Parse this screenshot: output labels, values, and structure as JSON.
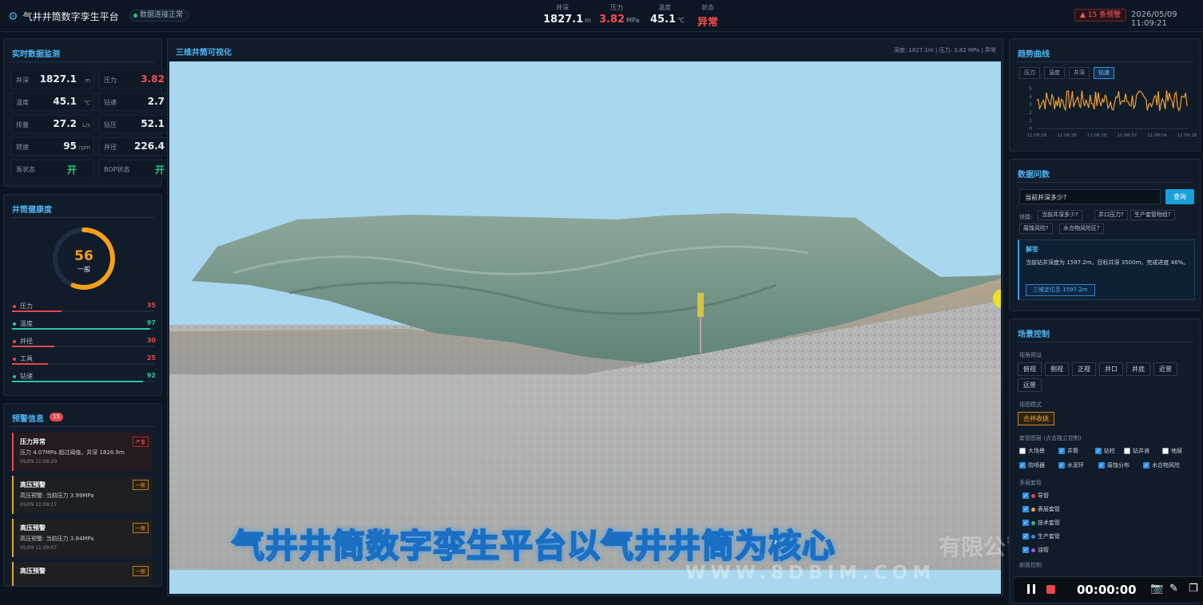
{
  "header": {
    "app_title": "气井井筒数字孪生平台",
    "connection": "数据连接正常",
    "metrics": [
      {
        "label": "井深",
        "value": "1827.1",
        "unit": "m"
      },
      {
        "label": "压力",
        "value": "3.82",
        "unit": "MPa"
      },
      {
        "label": "温度",
        "value": "45.1",
        "unit": "℃"
      },
      {
        "label": "状态",
        "value": "异常",
        "unit": ""
      }
    ],
    "alarm_badge": "▲ 15 条预警",
    "datetime": "2026/05/09 11:09:21"
  },
  "realtime": {
    "title": "实时数据监测",
    "cells": [
      {
        "key": "井深",
        "value": "1827.1",
        "unit": "m"
      },
      {
        "key": "压力",
        "value": "3.82",
        "unit": "M"
      },
      {
        "key": "温度",
        "value": "45.1",
        "unit": "℃"
      },
      {
        "key": "钻速",
        "value": "2.7",
        "unit": "m"
      },
      {
        "key": "排量",
        "value": "27.2",
        "unit": "L/s"
      },
      {
        "key": "钻压",
        "value": "52.1",
        "unit": "kl"
      },
      {
        "key": "转速",
        "value": "95",
        "unit": "rpm"
      },
      {
        "key": "井径",
        "value": "226.4",
        "unit": "m"
      },
      {
        "key": "泵状态",
        "value": "开",
        "unit": ""
      },
      {
        "key": "BOP状态",
        "value": "开",
        "unit": ""
      }
    ]
  },
  "health": {
    "title": "井筒健康度",
    "score": "56",
    "score_fraction": 0.56,
    "grade": "一般",
    "items": [
      {
        "label": "压力",
        "value": "35",
        "fraction": 0.35,
        "color": "#e8474f"
      },
      {
        "label": "温度",
        "value": "97",
        "fraction": 0.97,
        "color": "#2ec2a0"
      },
      {
        "label": "井径",
        "value": "30",
        "fraction": 0.3,
        "color": "#e8474f"
      },
      {
        "label": "工具",
        "value": "25",
        "fraction": 0.25,
        "color": "#e8474f"
      },
      {
        "label": "钻速",
        "value": "92",
        "fraction": 0.92,
        "color": "#2ec2a0"
      }
    ]
  },
  "alerts": {
    "title": "预警信息",
    "count": "15",
    "items": [
      {
        "title": "压力异常",
        "level": "严重",
        "desc": "压力 4.07MPa 超过阈值，井深 1826.9m",
        "time": "05/09 11:09:20"
      },
      {
        "title": "高压预警",
        "level": "一般",
        "desc": "高压预警: 当前压力 3.99MPa",
        "time": "05/09 11:09:17"
      },
      {
        "title": "高压预警",
        "level": "一般",
        "desc": "高压预警: 当前压力 3.84MPa",
        "time": "05/09 11:09:07"
      },
      {
        "title": "高压预警",
        "level": "一般",
        "desc": "",
        "time": ""
      }
    ]
  },
  "viewport": {
    "title": "三维井筒可视化",
    "info": "深度: 1827.1m | 压力: 3.82 MPa | 异常",
    "subtitle": "气井井筒数字孪生平台以气井井筒为核心",
    "watermark": "WWW.8DBIM.COM",
    "watermark2": "有限公司"
  },
  "trend": {
    "title": "趋势曲线",
    "tabs": [
      "压力",
      "温度",
      "井深",
      "钻速"
    ],
    "active_tab": "钻速",
    "y_ticks": [
      "5",
      "4",
      "3",
      "2",
      "1",
      "0"
    ],
    "x_ticks": [
      "11:08:26",
      "11:08:26",
      "11:08:26",
      "11:08:32",
      "11:08:54",
      "11:09:16"
    ],
    "line_color": "#f0a02a"
  },
  "qa": {
    "title": "数据问数",
    "input_value": "当前井深多少?",
    "query_button": "查询",
    "quick_label": "快捷:",
    "quick": [
      "当前井深多少?",
      "井口压力?",
      "生产套管物段?",
      "腐蚀风险?",
      "水合物风险区?"
    ],
    "answer_head": "解答",
    "answer_body": "当前钻井深度为 1597.2m，目标井深 3500m，完成进度 46%。",
    "answer_button": "三维定位至 1597.2m"
  },
  "scene": {
    "title": "场景控制",
    "view_label": "视角预设",
    "views": [
      "俯视",
      "侧视",
      "正视",
      "井口",
      "井底",
      "近景",
      "远景"
    ],
    "mode_label": "视图模式",
    "mode_button": "合并收拢",
    "layer_label": "套管图层 (点击独立控制)",
    "layers": [
      {
        "label": "大场景",
        "checked": false
      },
      {
        "label": "井筒",
        "checked": true
      },
      {
        "label": "钻柱",
        "checked": true
      },
      {
        "label": "钻井液",
        "checked": false
      },
      {
        "label": "地层",
        "checked": false
      },
      {
        "label": "防喷器",
        "checked": true
      },
      {
        "label": "水泥环",
        "checked": true
      },
      {
        "label": "腐蚀分布",
        "checked": true
      },
      {
        "label": "水合物风险",
        "checked": true
      }
    ],
    "casing_label": "多层套管",
    "casings": [
      {
        "label": "导管",
        "color": "#e8474f"
      },
      {
        "label": "表层套管",
        "color": "#e8a33d"
      },
      {
        "label": "技术套管",
        "color": "#2ec27e"
      },
      {
        "label": "生产套管",
        "color": "#2a8fe0"
      },
      {
        "label": "油管",
        "color": "#a05ae8"
      }
    ],
    "more_label": "剖面控制"
  },
  "recorder": {
    "time": "00:00:00"
  }
}
